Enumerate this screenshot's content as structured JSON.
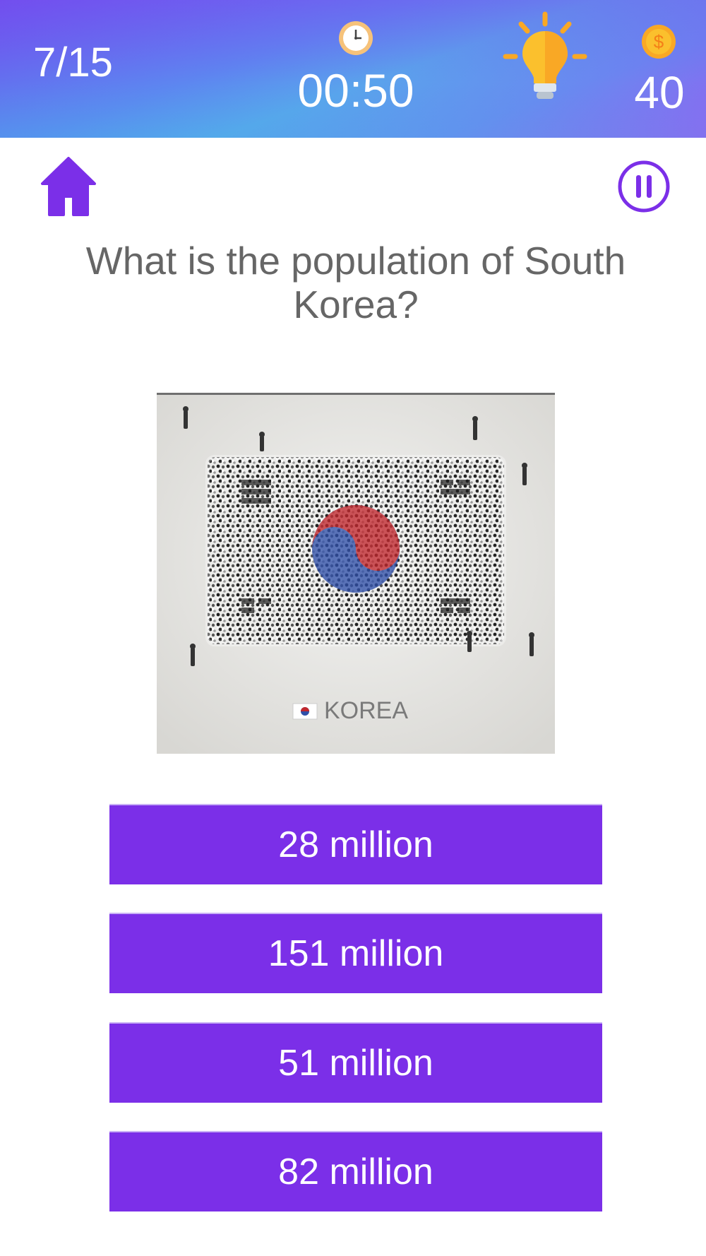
{
  "header": {
    "progress": "7/15",
    "timer": "00:50",
    "coins": "40",
    "icons": {
      "clock": "clock-icon",
      "hint": "lightbulb-icon",
      "coin": "dollar-coin-icon"
    }
  },
  "toolbar": {
    "home_icon": "home-icon",
    "pause_icon": "pause-icon"
  },
  "question": {
    "text": "What is the population of South Korea?"
  },
  "image": {
    "caption": "KOREA"
  },
  "answers": [
    {
      "label": "28 million"
    },
    {
      "label": "151 million"
    },
    {
      "label": "51 million"
    },
    {
      "label": "82 million"
    }
  ],
  "colors": {
    "accent": "#7b2fe8",
    "header_start": "#6a58ee",
    "header_end": "#9a58f2",
    "bulb": "#fbc02d",
    "coin": "#f9a825"
  }
}
